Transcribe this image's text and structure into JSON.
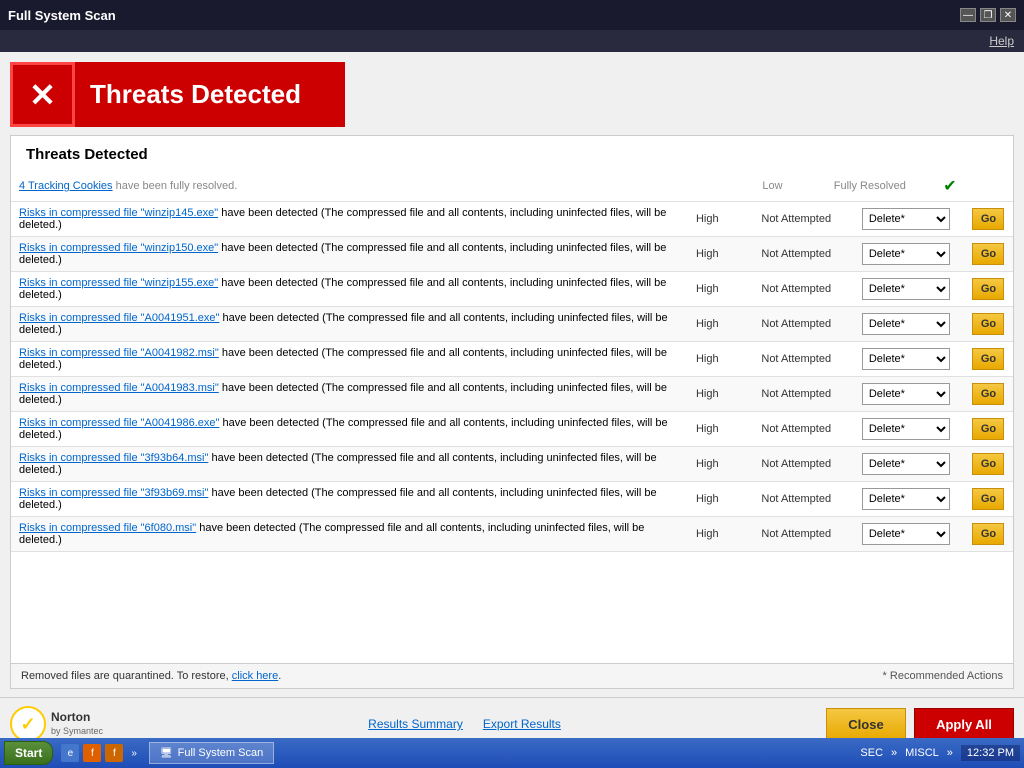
{
  "titleBar": {
    "title": "Full System Scan",
    "controls": {
      "minimize": "—",
      "restore": "❐",
      "close": "✕"
    },
    "helpLabel": "Help"
  },
  "banner": {
    "heading": "Threats Detected"
  },
  "section": {
    "heading": "Threats Detected"
  },
  "firstRow": {
    "description": "4 Tracking Cookies",
    "suffix": " have been fully resolved.",
    "severity": "Low",
    "status": "Fully Resolved"
  },
  "threats": [
    {
      "link": "Risks in compressed file \"winzip145.exe\"",
      "suffix": " have been detected (The compressed file and all contents, including uninfected files, will be deleted.)",
      "severity": "High",
      "status": "Not Attempted",
      "action": "Delete*"
    },
    {
      "link": "Risks in compressed file \"winzip150.exe\"",
      "suffix": " have been detected (The compressed file and all contents, including uninfected files, will be deleted.)",
      "severity": "High",
      "status": "Not Attempted",
      "action": "Delete*"
    },
    {
      "link": "Risks in compressed file \"winzip155.exe\"",
      "suffix": " have been detected (The compressed file and all contents, including uninfected files, will be deleted.)",
      "severity": "High",
      "status": "Not Attempted",
      "action": "Delete*"
    },
    {
      "link": "Risks in compressed file \"A0041951.exe\"",
      "suffix": " have been detected (The compressed file and all contents, including uninfected files, will be deleted.)",
      "severity": "High",
      "status": "Not Attempted",
      "action": "Delete*"
    },
    {
      "link": "Risks in compressed file \"A0041982.msi\"",
      "suffix": " have been detected (The compressed file and all contents, including uninfected files, will be deleted.)",
      "severity": "High",
      "status": "Not Attempted",
      "action": "Delete*"
    },
    {
      "link": "Risks in compressed file \"A0041983.msi\"",
      "suffix": " have been detected (The compressed file and all contents, including uninfected files, will be deleted.)",
      "severity": "High",
      "status": "Not Attempted",
      "action": "Delete*"
    },
    {
      "link": "Risks in compressed file \"A0041986.exe\"",
      "suffix": " have been detected (The compressed file and all contents, including uninfected files, will be deleted.)",
      "severity": "High",
      "status": "Not Attempted",
      "action": "Delete*"
    },
    {
      "link": "Risks in compressed file \"3f93b64.msi\"",
      "suffix": " have been detected (The compressed file and all contents, including uninfected files, will be deleted.)",
      "severity": "High",
      "status": "Not Attempted",
      "action": "Delete*"
    },
    {
      "link": "Risks in compressed file \"3f93b69.msi\"",
      "suffix": " have been detected (The compressed file and all contents, including uninfected files, will be deleted.)",
      "severity": "High",
      "status": "Not Attempted",
      "action": "Delete*"
    },
    {
      "link": "Risks in compressed file \"6f080.msi\"",
      "suffix": " have been detected (The compressed file and all contents, including uninfected files, will be deleted.)",
      "severity": "High",
      "status": "Not Attempted",
      "action": "Delete*"
    }
  ],
  "bottomBar": {
    "text": "Removed files are quarantined. To restore, ",
    "linkText": "click here",
    "note": "* Recommended Actions"
  },
  "footer": {
    "norton": {
      "name": "Norton",
      "sub": "by Symantec"
    },
    "links": {
      "summary": "Results Summary",
      "export": "Export Results"
    },
    "buttons": {
      "close": "Close",
      "applyAll": "Apply All"
    }
  },
  "taskbar": {
    "start": "Start",
    "activeWindow": "Full System Scan",
    "systemTray": {
      "labels": [
        "SEC",
        "MISCL"
      ],
      "time": "12:32 PM"
    }
  }
}
